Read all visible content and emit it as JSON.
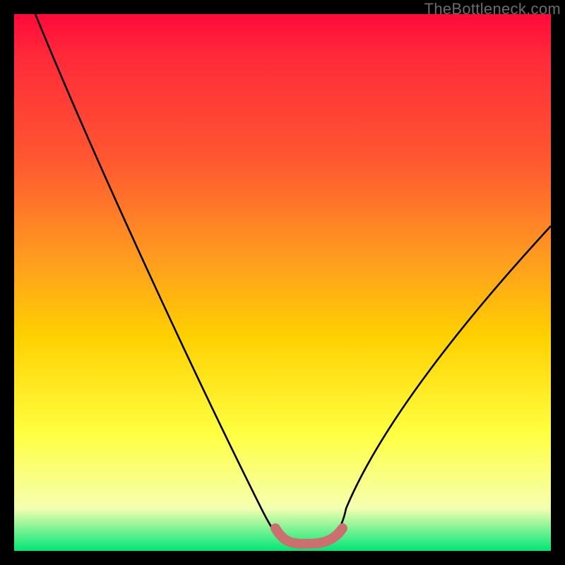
{
  "watermark": "TheBottleneck.com",
  "chart_data": {
    "type": "line",
    "title": "",
    "xlabel": "",
    "ylabel": "",
    "xlim": [
      0,
      100
    ],
    "ylim": [
      0,
      100
    ],
    "series": [
      {
        "name": "curve",
        "x": [
          4,
          10,
          20,
          30,
          40,
          46,
          50,
          52,
          56,
          60,
          62,
          70,
          80,
          90,
          100
        ],
        "values": [
          100,
          86,
          67,
          48,
          28,
          13,
          4,
          1.5,
          1.5,
          1.5,
          4,
          16,
          31,
          45,
          60
        ]
      }
    ],
    "highlight": {
      "x": [
        50,
        52,
        54,
        56,
        58,
        60,
        62
      ],
      "values": [
        4,
        2,
        1.5,
        1.5,
        1.5,
        2,
        4
      ]
    },
    "colors": {
      "curve": "#000000",
      "highlight": "#cc6f6f",
      "gradient_top": "#ff0a3a",
      "gradient_bottom": "#00e676"
    }
  }
}
